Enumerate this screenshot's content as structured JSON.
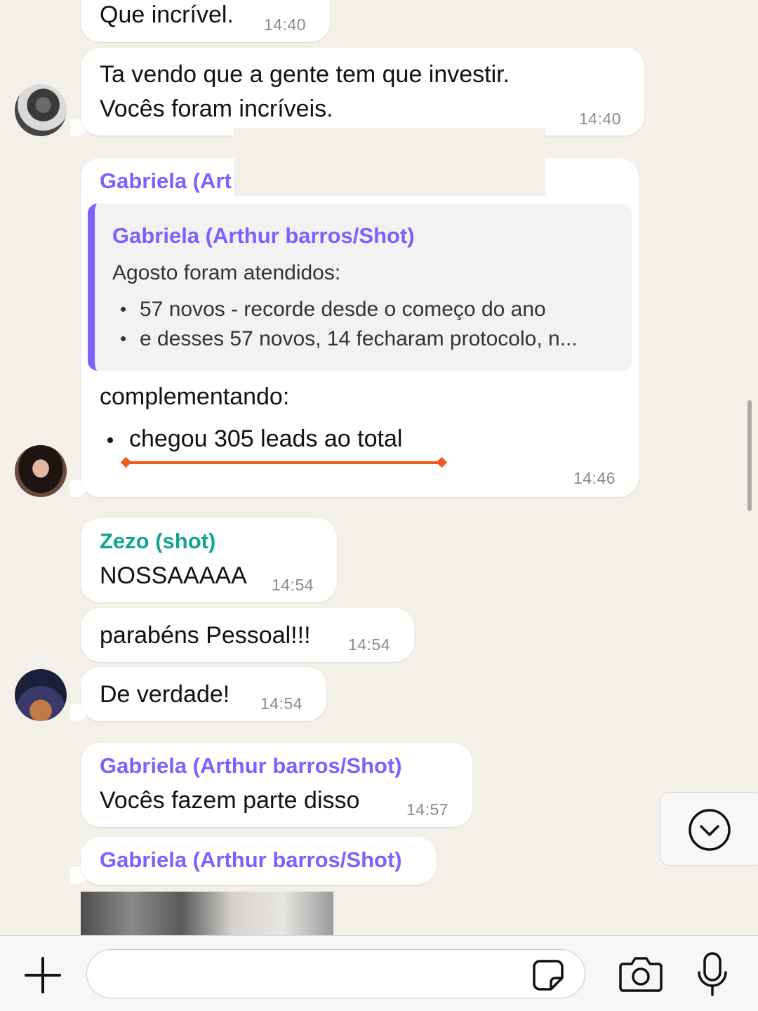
{
  "messages": [
    {
      "text": "Que incrível.",
      "time": "14:40"
    },
    {
      "line1": "Ta vendo que a gente tem que investir.",
      "line2": "Vocês foram incríveis.",
      "time": "14:40"
    },
    {
      "sender": "Gabriela (Art",
      "quote": {
        "sender": "Gabriela (Arthur barros/Shot)",
        "intro": "Agosto foram atendidos:",
        "bullets": [
          "57 novos - recorde desde o começo do ano",
          "e desses 57 novos, 14 fecharam protocolo, n..."
        ]
      },
      "text": "complementando:",
      "bullet": "chegou 305 leads ao total",
      "time": "14:46"
    },
    {
      "sender": "Zezo (shot)",
      "text": "NOSSAAAAA",
      "time": "14:54"
    },
    {
      "text": "parabéns Pessoal!!!",
      "time": "14:54"
    },
    {
      "text": "De verdade!",
      "time": "14:54"
    },
    {
      "sender": "Gabriela (Arthur barros/Shot)",
      "text": "Vocês fazem parte disso",
      "time": "14:57"
    },
    {
      "sender": "Gabriela (Arthur barros/Shot)"
    }
  ],
  "colors": {
    "background": "#f3efe9",
    "bubble": "#ffffff",
    "sender_gabriela": "#7b61ff",
    "sender_zezo": "#12a58f",
    "annotation": "#f05a1c"
  },
  "icons": {
    "plus": "plus-icon",
    "sticker": "sticker-icon",
    "camera": "camera-icon",
    "mic": "microphone-icon",
    "scroll_down": "chevron-down-icon"
  },
  "input": {
    "value": "",
    "placeholder": ""
  }
}
